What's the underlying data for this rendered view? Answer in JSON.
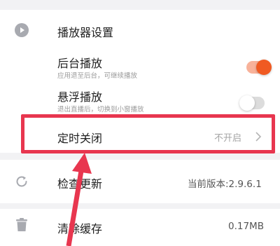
{
  "settings": {
    "player_section": {
      "title": "播放器设置",
      "background_play": {
        "label": "后台播放",
        "description": "应用退至后台，可继续播放",
        "enabled": true
      },
      "floating_play": {
        "label": "悬浮播放",
        "description": "退出直播后，切换到小窗播放",
        "enabled": false
      },
      "sleep_timer": {
        "label": "定时关闭",
        "value": "不开启"
      }
    },
    "check_update": {
      "label": "检查更新",
      "value": "当前版本:2.9.6.1"
    },
    "clear_cache": {
      "label": "清除缓存",
      "value": "0.17MB"
    }
  },
  "icons": {
    "player": "play-circle-icon",
    "update": "refresh-icon",
    "cache": "trash-icon",
    "chevron": "chevron-right-icon"
  },
  "colors": {
    "accent": "#f05a22",
    "highlight": "#e8364f"
  }
}
